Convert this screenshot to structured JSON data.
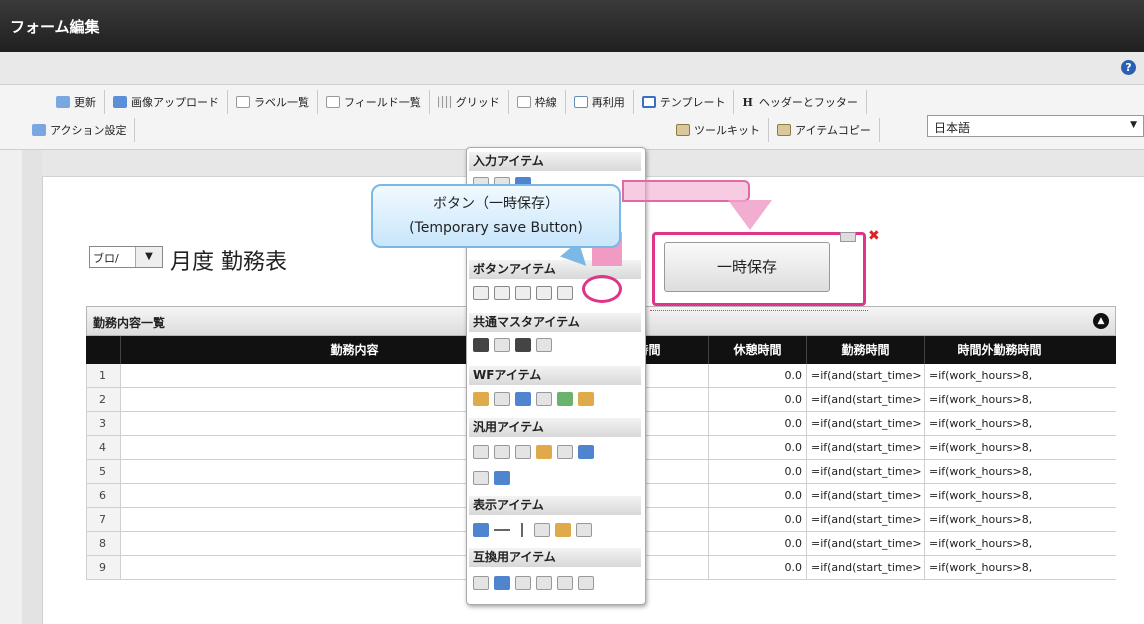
{
  "window": {
    "title": "フォーム編集"
  },
  "help_icon": "?",
  "toolbar": {
    "row1": [
      "更新",
      "画像アップロード",
      "ラベル一覧",
      "フィールド一覧",
      "グリッド",
      "枠線",
      "再利用",
      "テンプレート",
      "ヘッダーとフッター"
    ],
    "row2_left": "アクション設定",
    "toolkit": "ツールキット",
    "item_copy": "アイテムコピー",
    "language": "日本語"
  },
  "form": {
    "select_value": "ブロ/",
    "title": "月度 勤務表"
  },
  "table": {
    "title": "勤務内容一覧",
    "columns": [
      "勤務内容",
      "時間",
      "休憩時間",
      "勤務時間",
      "時間外勤務時間"
    ],
    "rows": [
      {
        "no": "1",
        "break": "0.0",
        "work": "=if(and(start_time>",
        "overtime": "=if(work_hours>8,"
      },
      {
        "no": "2",
        "break": "0.0",
        "work": "=if(and(start_time>",
        "overtime": "=if(work_hours>8,"
      },
      {
        "no": "3",
        "break": "0.0",
        "work": "=if(and(start_time>",
        "overtime": "=if(work_hours>8,"
      },
      {
        "no": "4",
        "break": "0.0",
        "work": "=if(and(start_time>",
        "overtime": "=if(work_hours>8,"
      },
      {
        "no": "5",
        "break": "0.0",
        "work": "=if(and(start_time>",
        "overtime": "=if(work_hours>8,"
      },
      {
        "no": "6",
        "break": "0.0",
        "work": "=if(and(start_time>",
        "overtime": "=if(work_hours>8,"
      },
      {
        "no": "7",
        "break": "0.0",
        "work": "=if(and(start_time>",
        "overtime": "=if(work_hours>8,"
      },
      {
        "no": "8",
        "break": "0.0",
        "work": "=if(and(start_time>",
        "overtime": "=if(work_hours>8,"
      },
      {
        "no": "9",
        "break": "0.0",
        "work": "=if(and(start_time>",
        "overtime": "=if(work_hours>8,"
      }
    ]
  },
  "palette": {
    "sections": [
      "入力アイテム",
      "ボタンアイテム",
      "共通マスタアイテム",
      "WFアイテム",
      "汎用アイテム",
      "表示アイテム",
      "互換用アイテム"
    ]
  },
  "callout": {
    "line1": "ボタン（一時保存）",
    "line2": "(Temporary save Button)"
  },
  "placed_button": {
    "label": "一時保存"
  },
  "colors": {
    "highlight": "#e0338a",
    "title_bar": "#2a2a2a",
    "callout_border": "#7cb8e5"
  }
}
